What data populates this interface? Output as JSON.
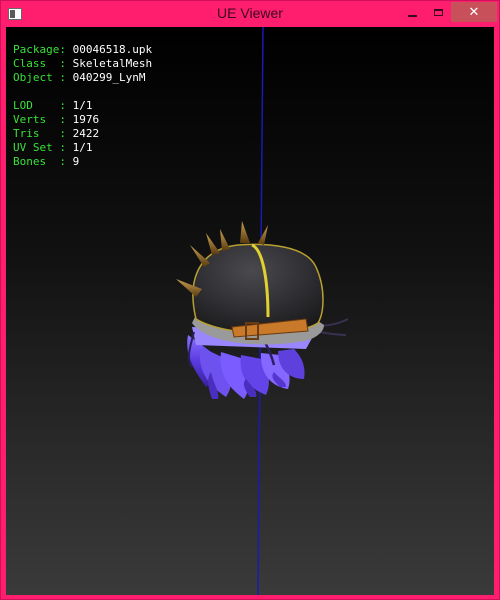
{
  "window": {
    "title": "UE Viewer",
    "accent_color": "#ff1e6e",
    "icons": {
      "app": "app-window-icon",
      "minimize": "minimize-icon",
      "maximize": "maximize-icon",
      "close": "close-icon"
    },
    "close_glyph": "✕"
  },
  "info": {
    "package": {
      "label": "Package:",
      "value": "00046518.upk"
    },
    "class": {
      "label": "Class  :",
      "value": "SkeletalMesh"
    },
    "object": {
      "label": "Object :",
      "value": "040299_LynM"
    },
    "lod": {
      "label": "LOD    :",
      "value": "1/1"
    },
    "verts": {
      "label": "Verts  :",
      "value": "1976"
    },
    "tris": {
      "label": "Tris   :",
      "value": "2422"
    },
    "uvset": {
      "label": "UV Set :",
      "value": "1/1"
    },
    "bones": {
      "label": "Bones  :",
      "value": "9"
    },
    "label_color": "#3ae03a",
    "value_color": "#ffffff"
  },
  "viewport": {
    "axis_color": "#1a1ab4",
    "mesh": "helmet-with-purple-hair"
  }
}
